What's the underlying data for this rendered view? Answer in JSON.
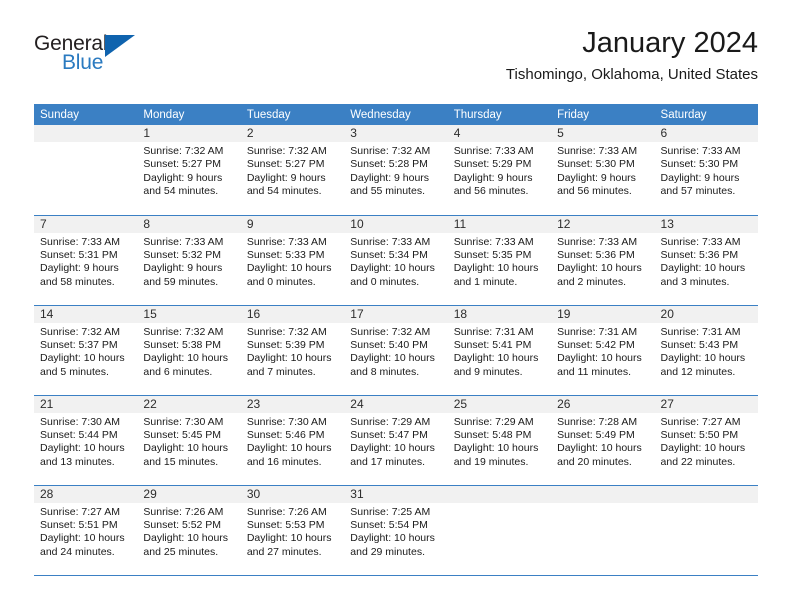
{
  "logo": {
    "word_one": "General",
    "word_two": "Blue",
    "triangle_color": "#0f63ae",
    "blue_color": "#2a7ac0"
  },
  "header": {
    "title": "January 2024",
    "subtitle": "Tishomingo, Oklahoma, United States"
  },
  "colors": {
    "header_blue": "#3b80c4",
    "daynum_band": "#f1f1f1",
    "text": "#1a1a1a"
  },
  "weekdays": [
    "Sunday",
    "Monday",
    "Tuesday",
    "Wednesday",
    "Thursday",
    "Friday",
    "Saturday"
  ],
  "weeks": [
    [
      {
        "day": "",
        "lines": [
          "",
          "",
          "",
          ""
        ]
      },
      {
        "day": "1",
        "lines": [
          "Sunrise: 7:32 AM",
          "Sunset: 5:27 PM",
          "Daylight: 9 hours",
          "and 54 minutes."
        ]
      },
      {
        "day": "2",
        "lines": [
          "Sunrise: 7:32 AM",
          "Sunset: 5:27 PM",
          "Daylight: 9 hours",
          "and 54 minutes."
        ]
      },
      {
        "day": "3",
        "lines": [
          "Sunrise: 7:32 AM",
          "Sunset: 5:28 PM",
          "Daylight: 9 hours",
          "and 55 minutes."
        ]
      },
      {
        "day": "4",
        "lines": [
          "Sunrise: 7:33 AM",
          "Sunset: 5:29 PM",
          "Daylight: 9 hours",
          "and 56 minutes."
        ]
      },
      {
        "day": "5",
        "lines": [
          "Sunrise: 7:33 AM",
          "Sunset: 5:30 PM",
          "Daylight: 9 hours",
          "and 56 minutes."
        ]
      },
      {
        "day": "6",
        "lines": [
          "Sunrise: 7:33 AM",
          "Sunset: 5:30 PM",
          "Daylight: 9 hours",
          "and 57 minutes."
        ]
      }
    ],
    [
      {
        "day": "7",
        "lines": [
          "Sunrise: 7:33 AM",
          "Sunset: 5:31 PM",
          "Daylight: 9 hours",
          "and 58 minutes."
        ]
      },
      {
        "day": "8",
        "lines": [
          "Sunrise: 7:33 AM",
          "Sunset: 5:32 PM",
          "Daylight: 9 hours",
          "and 59 minutes."
        ]
      },
      {
        "day": "9",
        "lines": [
          "Sunrise: 7:33 AM",
          "Sunset: 5:33 PM",
          "Daylight: 10 hours",
          "and 0 minutes."
        ]
      },
      {
        "day": "10",
        "lines": [
          "Sunrise: 7:33 AM",
          "Sunset: 5:34 PM",
          "Daylight: 10 hours",
          "and 0 minutes."
        ]
      },
      {
        "day": "11",
        "lines": [
          "Sunrise: 7:33 AM",
          "Sunset: 5:35 PM",
          "Daylight: 10 hours",
          "and 1 minute."
        ]
      },
      {
        "day": "12",
        "lines": [
          "Sunrise: 7:33 AM",
          "Sunset: 5:36 PM",
          "Daylight: 10 hours",
          "and 2 minutes."
        ]
      },
      {
        "day": "13",
        "lines": [
          "Sunrise: 7:33 AM",
          "Sunset: 5:36 PM",
          "Daylight: 10 hours",
          "and 3 minutes."
        ]
      }
    ],
    [
      {
        "day": "14",
        "lines": [
          "Sunrise: 7:32 AM",
          "Sunset: 5:37 PM",
          "Daylight: 10 hours",
          "and 5 minutes."
        ]
      },
      {
        "day": "15",
        "lines": [
          "Sunrise: 7:32 AM",
          "Sunset: 5:38 PM",
          "Daylight: 10 hours",
          "and 6 minutes."
        ]
      },
      {
        "day": "16",
        "lines": [
          "Sunrise: 7:32 AM",
          "Sunset: 5:39 PM",
          "Daylight: 10 hours",
          "and 7 minutes."
        ]
      },
      {
        "day": "17",
        "lines": [
          "Sunrise: 7:32 AM",
          "Sunset: 5:40 PM",
          "Daylight: 10 hours",
          "and 8 minutes."
        ]
      },
      {
        "day": "18",
        "lines": [
          "Sunrise: 7:31 AM",
          "Sunset: 5:41 PM",
          "Daylight: 10 hours",
          "and 9 minutes."
        ]
      },
      {
        "day": "19",
        "lines": [
          "Sunrise: 7:31 AM",
          "Sunset: 5:42 PM",
          "Daylight: 10 hours",
          "and 11 minutes."
        ]
      },
      {
        "day": "20",
        "lines": [
          "Sunrise: 7:31 AM",
          "Sunset: 5:43 PM",
          "Daylight: 10 hours",
          "and 12 minutes."
        ]
      }
    ],
    [
      {
        "day": "21",
        "lines": [
          "Sunrise: 7:30 AM",
          "Sunset: 5:44 PM",
          "Daylight: 10 hours",
          "and 13 minutes."
        ]
      },
      {
        "day": "22",
        "lines": [
          "Sunrise: 7:30 AM",
          "Sunset: 5:45 PM",
          "Daylight: 10 hours",
          "and 15 minutes."
        ]
      },
      {
        "day": "23",
        "lines": [
          "Sunrise: 7:30 AM",
          "Sunset: 5:46 PM",
          "Daylight: 10 hours",
          "and 16 minutes."
        ]
      },
      {
        "day": "24",
        "lines": [
          "Sunrise: 7:29 AM",
          "Sunset: 5:47 PM",
          "Daylight: 10 hours",
          "and 17 minutes."
        ]
      },
      {
        "day": "25",
        "lines": [
          "Sunrise: 7:29 AM",
          "Sunset: 5:48 PM",
          "Daylight: 10 hours",
          "and 19 minutes."
        ]
      },
      {
        "day": "26",
        "lines": [
          "Sunrise: 7:28 AM",
          "Sunset: 5:49 PM",
          "Daylight: 10 hours",
          "and 20 minutes."
        ]
      },
      {
        "day": "27",
        "lines": [
          "Sunrise: 7:27 AM",
          "Sunset: 5:50 PM",
          "Daylight: 10 hours",
          "and 22 minutes."
        ]
      }
    ],
    [
      {
        "day": "28",
        "lines": [
          "Sunrise: 7:27 AM",
          "Sunset: 5:51 PM",
          "Daylight: 10 hours",
          "and 24 minutes."
        ]
      },
      {
        "day": "29",
        "lines": [
          "Sunrise: 7:26 AM",
          "Sunset: 5:52 PM",
          "Daylight: 10 hours",
          "and 25 minutes."
        ]
      },
      {
        "day": "30",
        "lines": [
          "Sunrise: 7:26 AM",
          "Sunset: 5:53 PM",
          "Daylight: 10 hours",
          "and 27 minutes."
        ]
      },
      {
        "day": "31",
        "lines": [
          "Sunrise: 7:25 AM",
          "Sunset: 5:54 PM",
          "Daylight: 10 hours",
          "and 29 minutes."
        ]
      },
      {
        "day": "",
        "lines": [
          "",
          "",
          "",
          ""
        ]
      },
      {
        "day": "",
        "lines": [
          "",
          "",
          "",
          ""
        ]
      },
      {
        "day": "",
        "lines": [
          "",
          "",
          "",
          ""
        ]
      }
    ]
  ]
}
